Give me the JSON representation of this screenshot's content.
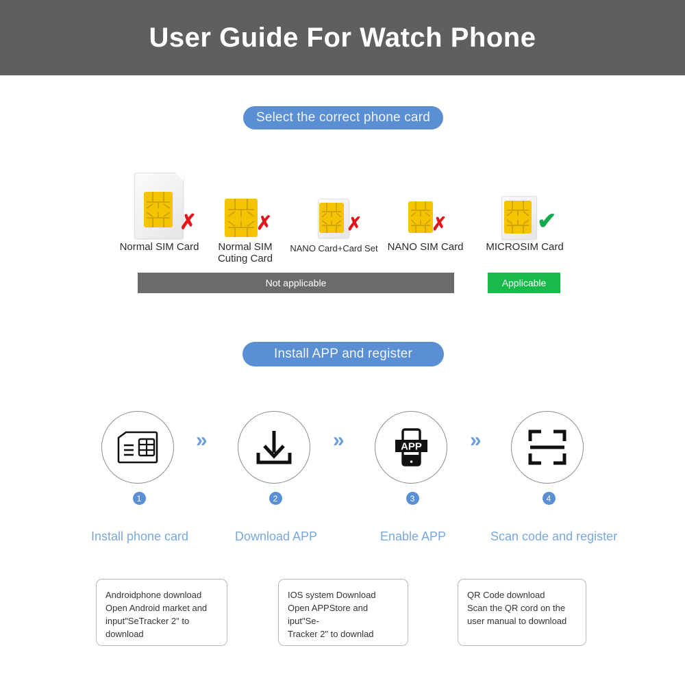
{
  "header": {
    "title": "User Guide For  Watch Phone",
    "bg_color": "#5f5f5f"
  },
  "section_sim": {
    "pill_label": "Select the correct phone card",
    "pill_color": "#5b8fd4",
    "cards": [
      {
        "label": "Normal SIM Card",
        "mark": "✗",
        "mark_type": "cross",
        "status": "not-applicable"
      },
      {
        "label": "Normal SIM\nCuting Card",
        "mark": "✗",
        "mark_type": "cross",
        "status": "not-applicable"
      },
      {
        "label": "NANO Card+Card Set",
        "mark": "✗",
        "mark_type": "cross",
        "status": "not-applicable"
      },
      {
        "label": "NANO SIM Card",
        "mark": "✗",
        "mark_type": "cross",
        "status": "not-applicable"
      },
      {
        "label": "MICROSIM Card",
        "mark": "✔",
        "mark_type": "check",
        "status": "applicable"
      }
    ],
    "bar_not_applicable": "Not applicable",
    "bar_applicable": "Applicable",
    "bar_not_color": "#6b6b6b",
    "bar_yes_color": "#18bb4a",
    "cross_color": "#e2161a",
    "check_color": "#11aa4d"
  },
  "section_app": {
    "pill_label": "Install APP and register",
    "arrow_glyph": "»",
    "steps": [
      {
        "number": "1",
        "label": "Install phone card",
        "icon": "sim-card-icon"
      },
      {
        "number": "2",
        "label": "Download APP",
        "icon": "download-icon"
      },
      {
        "number": "3",
        "label": "Enable APP",
        "icon": "app-phone-icon"
      },
      {
        "number": "4",
        "label": "Scan code and register",
        "icon": "qr-scan-icon"
      }
    ],
    "step_label_color": "#7aa8dd",
    "badge_color": "#5b8fd4"
  },
  "notes": [
    {
      "text": "Androidphone download\nOpen Android market and\ninput\"SeTracker 2\"  to\ndownload"
    },
    {
      "text": "IOS system Download\nOpen APPStore and iput\"Se-\nTracker 2\"  to downlad"
    },
    {
      "text": "QR Code download\nScan the QR cord on the\nuser manual to download"
    }
  ]
}
